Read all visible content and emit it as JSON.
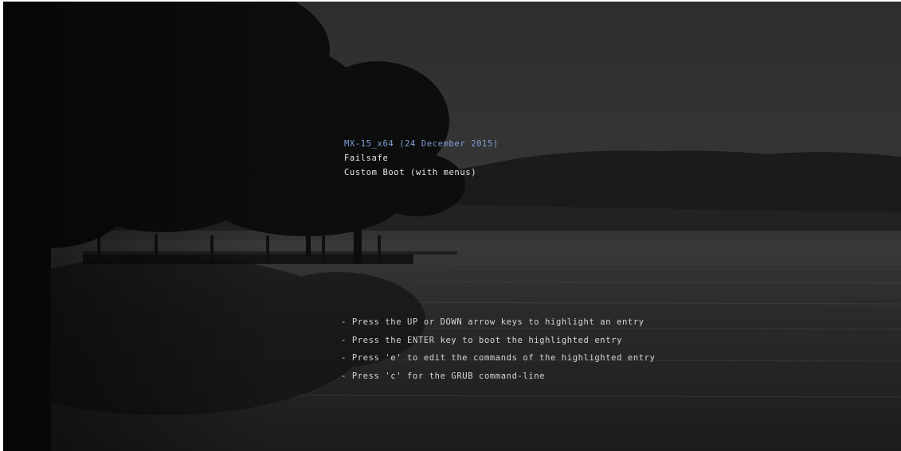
{
  "boot_menu": {
    "entries": [
      {
        "label": "MX-15_x64 (24 December 2015)",
        "selected": true
      },
      {
        "label": "Failsafe",
        "selected": false
      },
      {
        "label": "Custom Boot (with menus)",
        "selected": false
      }
    ],
    "selected_color": "#7f9fd8",
    "entry_color": "#e6e6e6"
  },
  "help": {
    "lines": [
      "- Press the UP or DOWN arrow keys to highlight an entry",
      "- Press the ENTER key to boot the highlighted entry",
      "- Press 'e' to edit the commands of the highlighted entry",
      "- Press 'c' for the GRUB command-line"
    ],
    "color": "#d6d6d6"
  },
  "background": {
    "description_icon": "lake-at-dusk-background-image",
    "sky_color": "#2c2c2c",
    "water_color": "#1e1e1e"
  }
}
